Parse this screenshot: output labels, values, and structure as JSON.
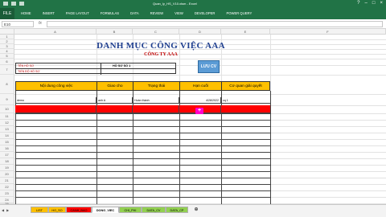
{
  "window": {
    "file_tab": "FILE",
    "title": "Quan_ly_HS_V10.xlsm - Excel",
    "tabs": [
      "HOME",
      "INSERT",
      "PAGE LAYOUT",
      "FORMULAS",
      "DATA",
      "REVIEW",
      "VIEW",
      "DEVELOPER",
      "POWER QUERY"
    ]
  },
  "formula_bar": {
    "name_box": "E10",
    "fx": "fx",
    "value": ""
  },
  "columns": [
    "A",
    "B",
    "C",
    "D",
    "E",
    "F"
  ],
  "rows": [
    "1",
    "2",
    "3",
    "4",
    "5",
    "6",
    "7",
    "8",
    "9",
    "10",
    "11",
    "12",
    "13",
    "14",
    "15",
    "16",
    "17",
    "18",
    "19",
    "20",
    "21",
    "22",
    "23",
    "24",
    "25"
  ],
  "sheet": {
    "title": "DANH MỤC CÔNG VIỆC AAA",
    "subtitle": "CÔNG TY AAA",
    "info": {
      "name_label": "TÊN HỒ SƠ",
      "name_value": "HỒ SƠ SỐ 1",
      "progress_label": "TIẾN ĐỘ HỒ SƠ"
    },
    "save_button": "LƯU CV",
    "table_headers": [
      "Nội dung công việc",
      "Giao cho",
      "Trạng thái",
      "Hạn cuối",
      "Cơ quan giải quyết"
    ],
    "rows": [
      [
        "demo",
        "anh A",
        "Hoàn thành",
        "4/28/2022",
        "cq 1"
      ],
      [
        "",
        "",
        "",
        "",
        ""
      ]
    ]
  },
  "sheet_tabs": [
    "LIST",
    "HO_SO",
    "CANH_BAO",
    "DONG_VIEC",
    "CHI_PHI",
    "DATA_CV",
    "DATA_CP"
  ],
  "colors": {
    "excel_green": "#217346",
    "header_fill": "#ffc000",
    "highlight_row": "#ff0000",
    "title_blue": "#1f3f8f",
    "subtitle_red": "#c00000"
  }
}
